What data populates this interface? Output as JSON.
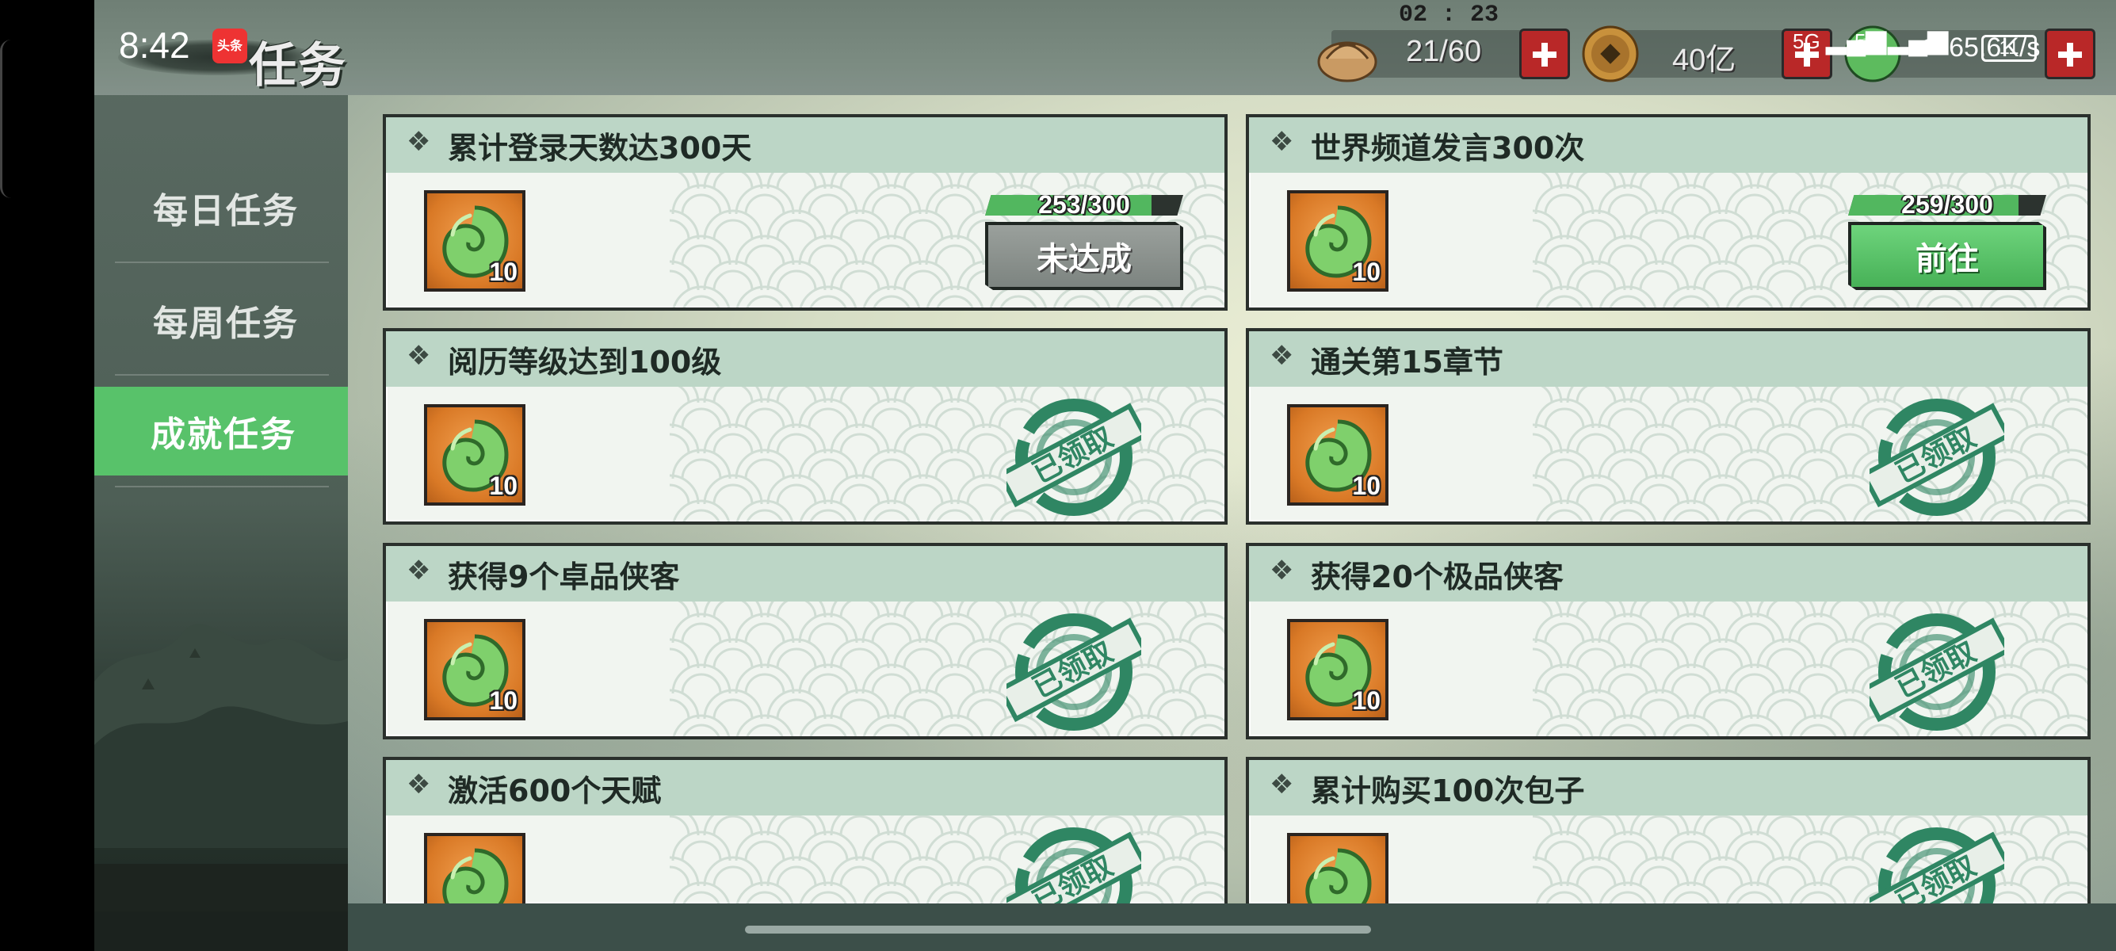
{
  "status_bar": {
    "time": "8:42",
    "app_badge": "头条",
    "network_1": "5G",
    "network_2": "5G",
    "battery_text": "65.6K/s",
    "battery_level": "11"
  },
  "header": {
    "title": "任务",
    "timer": "02 : 23",
    "stamina": "21/60",
    "coins": "40亿"
  },
  "nav": {
    "daily": "每日任务",
    "weekly": "每周任务",
    "achievement": "成就任务",
    "active": "achievement"
  },
  "tasks": [
    {
      "title": "累计登录天数达300天",
      "reward_count": "10",
      "progress_text": "253/300",
      "progress": 0.843,
      "button": "未达成",
      "state": "incomplete"
    },
    {
      "title": "世界频道发言300次",
      "reward_count": "10",
      "progress_text": "259/300",
      "progress": 0.863,
      "button": "前往",
      "state": "go"
    },
    {
      "title": "阅历等级达到100级",
      "reward_count": "10",
      "stamp": "已领取",
      "state": "claimed"
    },
    {
      "title": "通关第15章节",
      "reward_count": "10",
      "stamp": "已领取",
      "state": "claimed"
    },
    {
      "title": "获得9个卓品侠客",
      "reward_count": "10",
      "stamp": "已领取",
      "state": "claimed"
    },
    {
      "title": "获得20个极品侠客",
      "reward_count": "10",
      "stamp": "已领取",
      "state": "claimed"
    },
    {
      "title": "激活600个天赋",
      "reward_count": "10",
      "stamp": "已领取",
      "state": "claimed"
    },
    {
      "title": "累计购买100次包子",
      "reward_count": "10",
      "stamp": "已领取",
      "state": "claimed"
    }
  ],
  "icons": {
    "reward": "jade-swirl-icon",
    "stamina": "bun-icon",
    "coin": "copper-coin-icon",
    "gem": "jade-gem-icon"
  },
  "colors": {
    "accent_green": "#58c26a",
    "card_header": "#bcd6c6",
    "plus_red": "#b92828"
  }
}
